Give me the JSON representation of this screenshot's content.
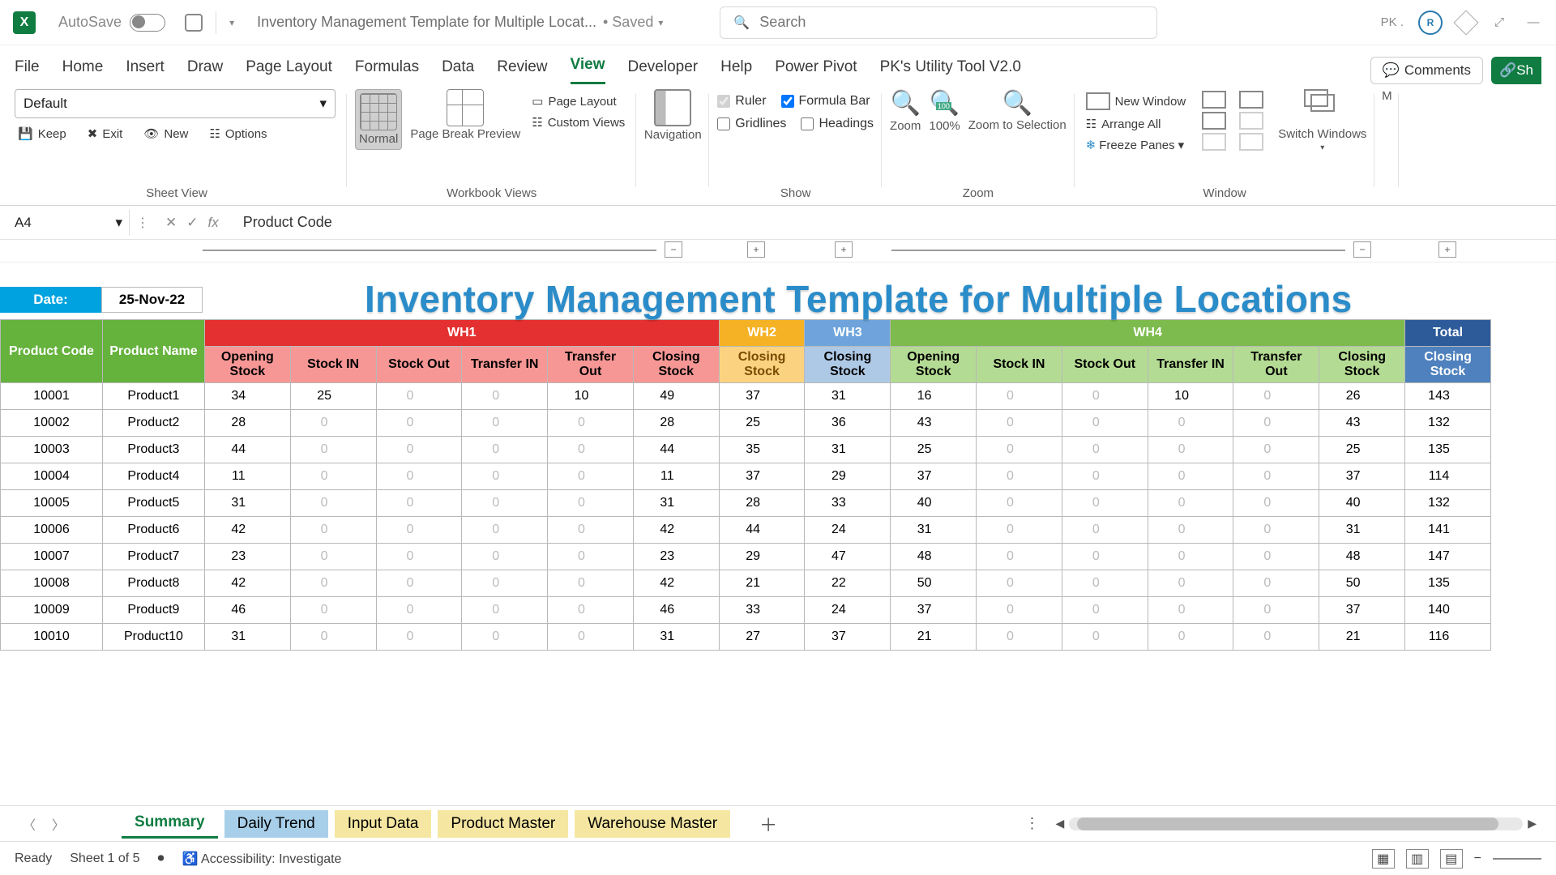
{
  "titlebar": {
    "autosave_label": "AutoSave",
    "autosave_state": "On",
    "doc_title": "Inventory Management Template for Multiple Locat...",
    "saved_label": "Saved",
    "search_placeholder": "Search",
    "user_initials": "PK ."
  },
  "tabs": [
    "File",
    "Home",
    "Insert",
    "Draw",
    "Page Layout",
    "Formulas",
    "Data",
    "Review",
    "View",
    "Developer",
    "Help",
    "Power Pivot",
    "PK's Utility Tool V2.0"
  ],
  "active_tab": "View",
  "comments_label": "Comments",
  "share_label": "Sh",
  "ribbon": {
    "sheet_view": {
      "select": "Default",
      "keep": "Keep",
      "exit": "Exit",
      "new": "New",
      "options": "Options",
      "group": "Sheet View"
    },
    "workbook_views": {
      "normal": "Normal",
      "page_break": "Page Break Preview",
      "page_layout": "Page Layout",
      "custom": "Custom Views",
      "group": "Workbook Views"
    },
    "navigation": {
      "label": "Navigation"
    },
    "show": {
      "ruler": "Ruler",
      "formula_bar": "Formula Bar",
      "gridlines": "Gridlines",
      "headings": "Headings",
      "group": "Show"
    },
    "zoom": {
      "zoom": "Zoom",
      "hundred": "100%",
      "to_selection": "Zoom to Selection",
      "group": "Zoom"
    },
    "window": {
      "new_window": "New Window",
      "arrange": "Arrange All",
      "freeze": "Freeze Panes",
      "switch": "Switch Windows",
      "group": "Window"
    },
    "macros": "M"
  },
  "namebox": "A4",
  "formula_text": "Product Code",
  "sheet": {
    "date_label": "Date:",
    "date_value": "25-Nov-22",
    "main_title": "Inventory Management Template for Multiple Locations",
    "groups": [
      "WH1",
      "WH2",
      "WH3",
      "WH4",
      "Total"
    ],
    "id_header1": "Product Code",
    "id_header2": "Product Name",
    "sub_wh1": [
      "Opening Stock",
      "Stock IN",
      "Stock Out",
      "Transfer IN",
      "Transfer Out",
      "Closing Stock"
    ],
    "sub_wh2": [
      "Closing Stock"
    ],
    "sub_wh3": [
      "Closing Stock"
    ],
    "sub_wh4": [
      "Opening Stock",
      "Stock IN",
      "Stock Out",
      "Transfer IN",
      "Transfer Out",
      "Closing Stock"
    ],
    "sub_total": [
      "Closing Stock"
    ],
    "rows": [
      {
        "code": "10001",
        "name": "Product1",
        "wh1": [
          34,
          25,
          0,
          0,
          10,
          49
        ],
        "wh2": 37,
        "wh3": 31,
        "wh4": [
          16,
          0,
          0,
          10,
          0,
          26
        ],
        "tot": 143
      },
      {
        "code": "10002",
        "name": "Product2",
        "wh1": [
          28,
          0,
          0,
          0,
          0,
          28
        ],
        "wh2": 25,
        "wh3": 36,
        "wh4": [
          43,
          0,
          0,
          0,
          0,
          43
        ],
        "tot": 132
      },
      {
        "code": "10003",
        "name": "Product3",
        "wh1": [
          44,
          0,
          0,
          0,
          0,
          44
        ],
        "wh2": 35,
        "wh3": 31,
        "wh4": [
          25,
          0,
          0,
          0,
          0,
          25
        ],
        "tot": 135
      },
      {
        "code": "10004",
        "name": "Product4",
        "wh1": [
          11,
          0,
          0,
          0,
          0,
          11
        ],
        "wh2": 37,
        "wh3": 29,
        "wh4": [
          37,
          0,
          0,
          0,
          0,
          37
        ],
        "tot": 114
      },
      {
        "code": "10005",
        "name": "Product5",
        "wh1": [
          31,
          0,
          0,
          0,
          0,
          31
        ],
        "wh2": 28,
        "wh3": 33,
        "wh4": [
          40,
          0,
          0,
          0,
          0,
          40
        ],
        "tot": 132
      },
      {
        "code": "10006",
        "name": "Product6",
        "wh1": [
          42,
          0,
          0,
          0,
          0,
          42
        ],
        "wh2": 44,
        "wh3": 24,
        "wh4": [
          31,
          0,
          0,
          0,
          0,
          31
        ],
        "tot": 141
      },
      {
        "code": "10007",
        "name": "Product7",
        "wh1": [
          23,
          0,
          0,
          0,
          0,
          23
        ],
        "wh2": 29,
        "wh3": 47,
        "wh4": [
          48,
          0,
          0,
          0,
          0,
          48
        ],
        "tot": 147
      },
      {
        "code": "10008",
        "name": "Product8",
        "wh1": [
          42,
          0,
          0,
          0,
          0,
          42
        ],
        "wh2": 21,
        "wh3": 22,
        "wh4": [
          50,
          0,
          0,
          0,
          0,
          50
        ],
        "tot": 135
      },
      {
        "code": "10009",
        "name": "Product9",
        "wh1": [
          46,
          0,
          0,
          0,
          0,
          46
        ],
        "wh2": 33,
        "wh3": 24,
        "wh4": [
          37,
          0,
          0,
          0,
          0,
          37
        ],
        "tot": 140
      },
      {
        "code": "10010",
        "name": "Product10",
        "wh1": [
          31,
          0,
          0,
          0,
          0,
          31
        ],
        "wh2": 27,
        "wh3": 37,
        "wh4": [
          21,
          0,
          0,
          0,
          0,
          21
        ],
        "tot": 116
      }
    ]
  },
  "sheet_tabs": {
    "summary": "Summary",
    "daily": "Daily Trend",
    "input": "Input Data",
    "product": "Product Master",
    "warehouse": "Warehouse Master"
  },
  "status": {
    "ready": "Ready",
    "sheet": "Sheet 1 of 5",
    "accessibility": "Accessibility: Investigate"
  }
}
